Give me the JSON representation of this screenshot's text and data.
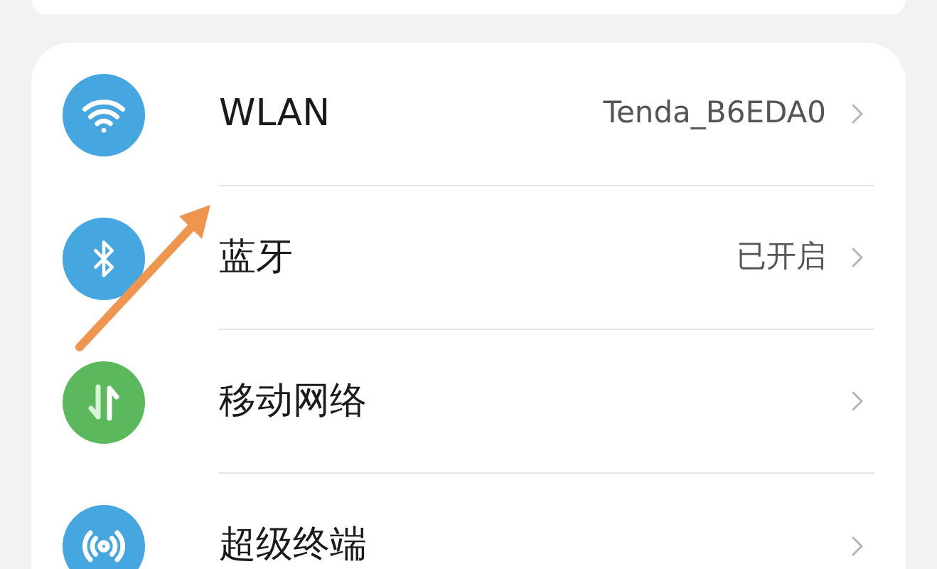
{
  "settings_list": [
    {
      "kind": "wifi",
      "color": "#45a6e0",
      "label": "WLAN",
      "value": "Tenda_B6EDA0"
    },
    {
      "kind": "bluetooth",
      "color": "#45a6e0",
      "label": "蓝牙",
      "value": "已开启"
    },
    {
      "kind": "mobile-data",
      "color": "#5cb85c",
      "label": "移动网络"
    },
    {
      "kind": "super-device",
      "color": "#45a6e0",
      "label": "超级终端"
    }
  ]
}
